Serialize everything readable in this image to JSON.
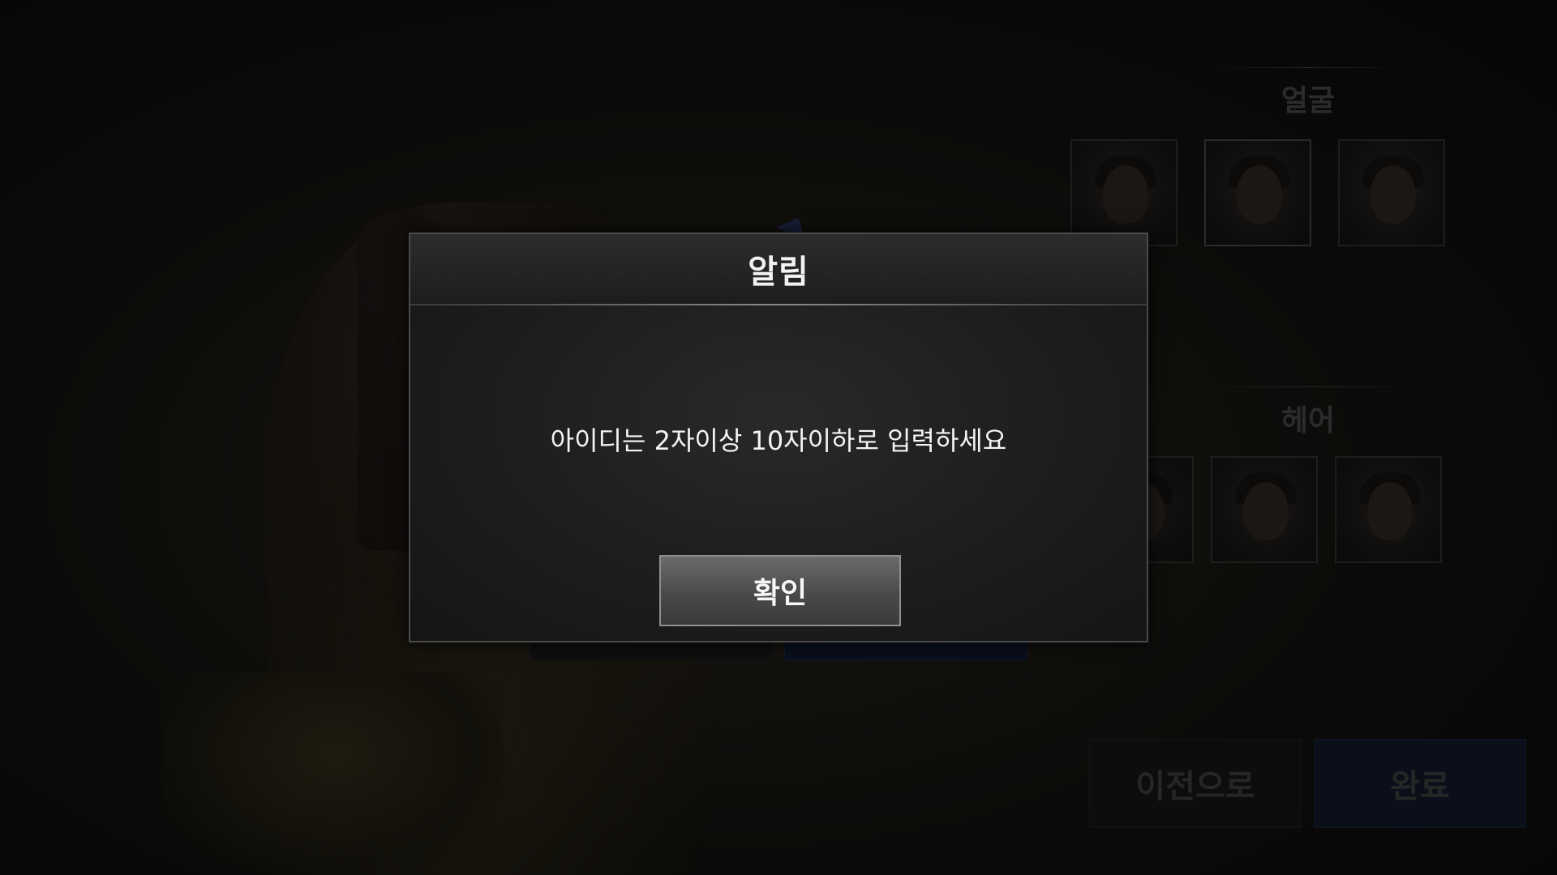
{
  "panel": {
    "face_title": "얼굴",
    "hair_title": "헤어"
  },
  "footer": {
    "prev_label": "이전으로",
    "done_label": "완료"
  },
  "dialog": {
    "title": "알림",
    "message": "아이디는 2자이상 10자이하로 입력하세요",
    "confirm_label": "확인"
  },
  "colors": {
    "dialog_border": "#4a4a4a",
    "button_bg": "#4a4a4a",
    "done_button_bg": "#0a0f1a"
  }
}
